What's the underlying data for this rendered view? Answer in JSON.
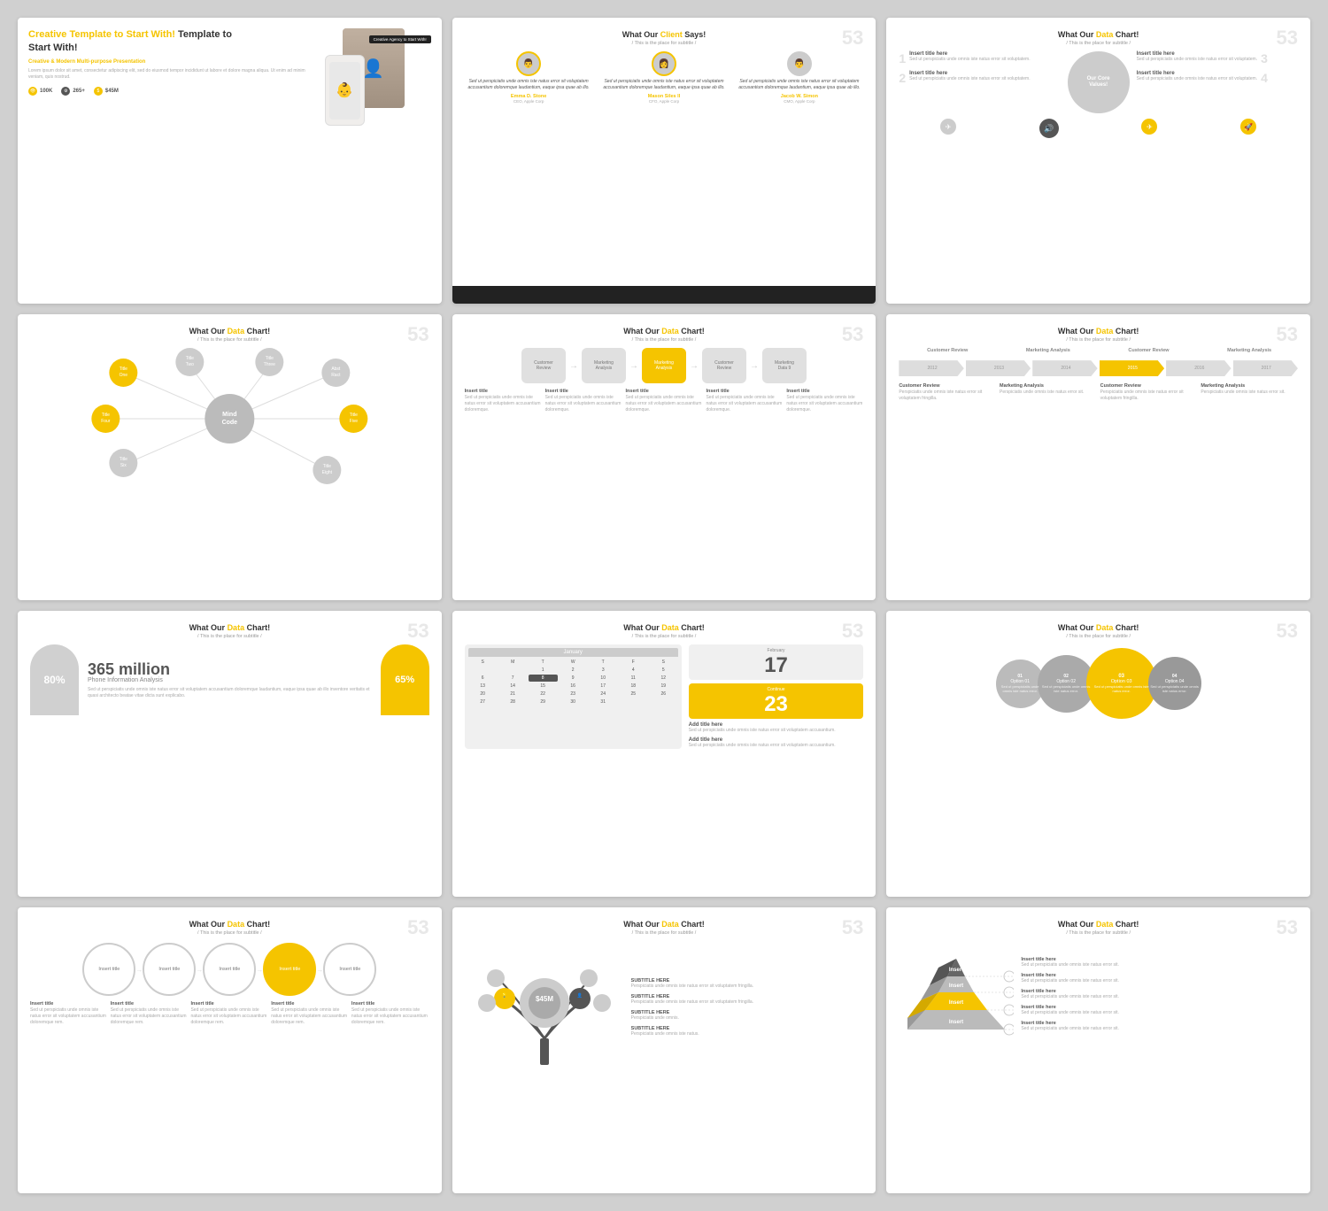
{
  "slides": [
    {
      "id": "slide-1",
      "title": "Creative Template to Start With!",
      "subtitle": "Creative & Modern Multi-purpose Presentation",
      "body": "Lorem ipsum dolor sit amet, consectetur adipiscing elit, sed do eiusmod tempor incididunt ut labore et dolore magna aliqua. Ut enim ad minim veniam, quis nostrud.",
      "stats": [
        "100K",
        "265+",
        "$45M"
      ],
      "cta": "Creative Agency to Start With!",
      "number": ""
    },
    {
      "id": "slide-2",
      "title": "What Our Client Says!",
      "accent_word": "Client",
      "subtitle": "/ This is the place for subtitle /",
      "number": "53",
      "testimonials": [
        {
          "quote": "Sed ut perspiciatis unde omnis iste natus error sit voluptatem accusantium doloremque laudantium, eaque ipsa quae ab illo.",
          "name": "Emma D. Stone",
          "role": "CEO, Apple Corp"
        },
        {
          "quote": "Sed ut perspiciatis unde omnis iste natus error sit voluptatem accusantium doloremque laudantium, eaque ipsa quae ab illo.",
          "name": "Mason Siles II",
          "role": "CFO, Apple Corp"
        },
        {
          "quote": "Sed ut perspiciatis unde omnis iste natus error sit voluptatem accusantium doloremque laudantium, eaque ipsa quae ab illo.",
          "name": "Jacob W. Simon",
          "role": "CMO, Apple Corp"
        }
      ]
    },
    {
      "id": "slide-3",
      "title": "What Our Data Chart!",
      "accent_word": "Data",
      "subtitle": "/ This is the place for subtitle /",
      "number": "53",
      "core_values": [
        {
          "num": "1",
          "title": "Insert title here",
          "body": "Sed ut perspiciatis unde omnis iste natus error sit voluptatem."
        },
        {
          "num": "2",
          "title": "Insert title here",
          "body": "Sed ut perspiciatis unde omnis iste natus error sit voluptatem."
        },
        {
          "num": "3",
          "title": "Insert title here",
          "body": "Sed ut perspiciatis unde omnis iste natus error sit voluptatem."
        },
        {
          "num": "4",
          "title": "Insert title here",
          "body": "Sed ut perspiciatis unde omnis iste natus error sit voluptatem."
        }
      ]
    },
    {
      "id": "slide-4",
      "title": "What Our Data Chart!",
      "accent_word": "Data",
      "subtitle": "/ This is the place for subtitle /",
      "number": "53",
      "mind_center": "Mind Code",
      "nodes": [
        "Title One",
        "Title Two",
        "Title Three",
        "Title Four",
        "Title Five",
        "Title Six",
        "Title Seven",
        "Title Eight"
      ]
    },
    {
      "id": "slide-5",
      "title": "What Our Data Chart!",
      "accent_word": "Data",
      "subtitle": "/ This is the place for subtitle /",
      "number": "53",
      "process_items": [
        {
          "label": "Customer Review",
          "type": "gray"
        },
        {
          "label": "Marketing Analysis",
          "type": "gray"
        },
        {
          "label": "Marketing Analysis",
          "type": "yellow"
        },
        {
          "label": "Customer Review",
          "type": "gray"
        },
        {
          "label": "Marketing Data 9",
          "type": "gray"
        }
      ],
      "items": [
        {
          "title": "Insert title",
          "desc": "Sed ut perspiciatis unde omnis iste natus error sit voluptatem accusantium doloremque."
        },
        {
          "title": "Insert title",
          "desc": "Sed ut perspiciatis unde omnis iste natus error sit voluptatem accusantium doloremque."
        },
        {
          "title": "Insert title",
          "desc": "Sed ut perspiciatis unde omnis iste natus error sit voluptatem accusantium doloremque."
        },
        {
          "title": "Insert title",
          "desc": "Sed ut perspiciatis unde omnis iste natus error sit voluptatem accusantium doloremque."
        },
        {
          "title": "Insert title",
          "desc": "Sed ut perspiciatis unde omnis iste natus error sit voluptatem accusantium doloremque."
        }
      ]
    },
    {
      "id": "slide-6",
      "title": "What Our Data Chart!",
      "accent_word": "Data",
      "subtitle": "/ This is the place for subtitle /",
      "number": "53",
      "timeline_items": [
        {
          "label": "Customer Review",
          "type": "gray"
        },
        {
          "label": "Marketing Analysis",
          "type": "gray"
        },
        {
          "label": "2014",
          "type": "gray"
        },
        {
          "label": "2015",
          "type": "yellow"
        },
        {
          "label": "2016",
          "type": "gray"
        },
        {
          "label": "2017",
          "type": "gray"
        }
      ],
      "bottom_cols": [
        {
          "title": "Customer Review",
          "body": "Perspiciatis unde omnis iste natus error sit voluptatem fringilla."
        },
        {
          "title": "Marketing Analysis",
          "body": "Perspiciatis unde omnis iste natus error sit."
        },
        {
          "title": "Customer Review",
          "body": "Perspiciatis unde omnis iste natus error sit voluptatem fringilla."
        },
        {
          "title": "Marketing Analysis",
          "body": "Perspiciatis unde omnis iste natus error sit."
        }
      ]
    },
    {
      "id": "slide-7",
      "title": "What Our Data Chart!",
      "accent_word": "Data",
      "subtitle": "/ This is the place for subtitle /",
      "number": "53",
      "pct1": "80%",
      "big_num": "365 million",
      "big_label": "Phone Information Analysis",
      "pct2": "65%",
      "body_text": "Sed ut perspiciatis unde omnis iste natus error sit voluptatem accusantium doloremque laudantium, eaque ipsa quae ab illo inventore veritatis et quasi architecto beatae vitae dicta sunt explicabo."
    },
    {
      "id": "slide-8",
      "title": "What Our Data Chart!",
      "accent_word": "Data",
      "subtitle": "/ This is the place for subtitle /",
      "number": "53",
      "calendar_month": "January",
      "days": [
        "S",
        "M",
        "T",
        "W",
        "T",
        "F",
        "S"
      ],
      "dates1": [
        "",
        "",
        "1",
        "2",
        "3",
        "4",
        "5",
        "6",
        "7",
        "8",
        "9",
        "10",
        "11",
        "12",
        "13",
        "14",
        "15",
        "16",
        "17",
        "18",
        "19",
        "20",
        "21",
        "22",
        "23",
        "24",
        "25",
        "26",
        "27",
        "28",
        "29",
        "30",
        "31",
        "",
        ""
      ],
      "highlight_date": "8",
      "cal2_month": "February",
      "cal2_num": "17",
      "cal3_num": "23",
      "cal3_month": "Continue",
      "add_title1": "Add title here",
      "add_body1": "Sed ut perspiciatis unde omnis iste natus error sit voluptatem accusantium.",
      "add_title2": "Add title here",
      "add_body2": "Sed ut perspiciatis unde omnis iste natus error sit voluptatem accusantium."
    },
    {
      "id": "slide-9",
      "title": "What Our Data Chart!",
      "accent_word": "Data",
      "subtitle": "/ This is the place for subtitle /",
      "number": "53",
      "options": [
        {
          "label": "Option 01",
          "size": "sm",
          "desc": "Sed ut perspiciatis unde omnis iste natus error."
        },
        {
          "label": "Option 02",
          "size": "md",
          "desc": "Sed ut perspiciatis unde omnis iste natus error."
        },
        {
          "label": "Option 03",
          "size": "lg",
          "desc": "Sed ut perspiciatis unde omnis iste natus error."
        },
        {
          "label": "Option 04",
          "size": "sm2",
          "desc": "Sed ut perspiciatis unde omnis iste natus error."
        }
      ]
    },
    {
      "id": "slide-10",
      "title": "What Our Data Chart!",
      "accent_word": "Data",
      "subtitle": "/ This is the place for subtitle /",
      "number": "53",
      "circles": [
        {
          "label": "Insert title",
          "type": "outline"
        },
        {
          "label": "Insert title",
          "type": "outline"
        },
        {
          "label": "Insert title",
          "type": "outline"
        },
        {
          "label": "Insert title",
          "type": "yellow"
        },
        {
          "label": "Insert title",
          "type": "outline"
        }
      ],
      "circle_labels": [
        {
          "title": "Insert title",
          "body": "Sed ut perspiciatis unde omnis iste natus error sit voluptatem accusantium doloremque rem."
        },
        {
          "title": "Insert title",
          "body": "Sed ut perspiciatis unde omnis iste natus error sit voluptatem accusantium doloremque rem."
        },
        {
          "title": "Insert title",
          "body": "Sed ut perspiciatis unde omnis iste natus error sit voluptatem accusantium doloremque rem."
        },
        {
          "title": "Insert title",
          "body": "Sed ut perspiciatis unde omnis iste natus error sit voluptatem accusantium doloremque rem."
        },
        {
          "title": "Insert title",
          "body": "Sed ut perspiciatis unde omnis iste natus error sit voluptatem accusantium doloremque rem."
        }
      ]
    },
    {
      "id": "slide-11",
      "title": "What Our Data Chart!",
      "accent_word": "Data",
      "subtitle": "/ This is the place for subtitle /",
      "number": "53",
      "tree_center": "$45M",
      "tree_nodes": [
        "SUBTITLE HERE",
        "SUBTITLE HERE",
        "SUBTITLE HERE",
        "SUBTITLE HERE"
      ],
      "tree_descs": [
        "Perspiciatis unde omnis iste natus error sit voluptatem fringilla.",
        "Perspiciatis unde omnis iste natus error sit voluptatem fringilla.",
        "Perspiciatis unde omnis.",
        "Perspiciatis unde omnis iste natus."
      ]
    },
    {
      "id": "slide-12",
      "title": "What Our Data Chart!",
      "accent_word": "Data",
      "subtitle": "/ This is the place for subtitle /",
      "number": "53",
      "pyramid_labels": [
        "Insert",
        "Insert",
        "Insert",
        "Insert"
      ],
      "list_items": [
        {
          "title": "Insert title here",
          "body": "Sed ut perspiciatis unde omnis iste natus error sit."
        },
        {
          "title": "Insert title here",
          "body": "Sed ut perspiciatis unde omnis iste natus error sit."
        },
        {
          "title": "Insert title here",
          "body": "Sed ut perspiciatis unde omnis iste natus error sit."
        },
        {
          "title": "Insert title here",
          "body": "Sed ut perspiciatis unde omnis iste natus error sit."
        },
        {
          "title": "Insert title here",
          "body": "Sed ut perspiciatis unde omnis iste natus error sit."
        }
      ]
    }
  ]
}
